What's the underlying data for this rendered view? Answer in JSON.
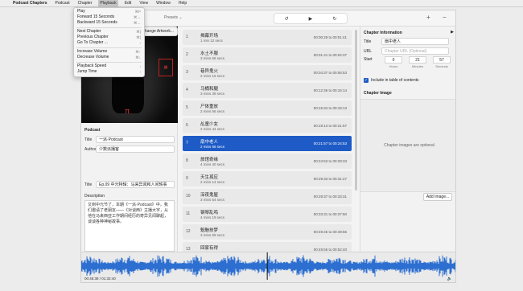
{
  "menubar": {
    "apple": "",
    "app": "Podcast Chapters",
    "items": [
      "Podcast",
      "Chapter",
      "Playback",
      "Edit",
      "View",
      "Window",
      "Help"
    ]
  },
  "menu": {
    "items": [
      {
        "label": "Play",
        "shortcut": "⌘P"
      },
      {
        "label": "Forward 15 Seconds",
        "shortcut": "⌘→"
      },
      {
        "label": "Backward 15 Seconds",
        "shortcut": "⌘←"
      },
      {
        "sep": true
      },
      {
        "label": "Next Chapter",
        "shortcut": "⌘]"
      },
      {
        "label": "Previous Chapter",
        "shortcut": "⌘["
      },
      {
        "label": "Go To Chapter ...",
        "shortcut": "›"
      },
      {
        "sep": true
      },
      {
        "label": "Increase Volume",
        "shortcut": "⌘↑"
      },
      {
        "label": "Decrease Volume",
        "shortcut": "⌘↓"
      },
      {
        "sep": true
      },
      {
        "label": "Playback Speed",
        "shortcut": "›"
      },
      {
        "label": "Jump Time",
        "shortcut": "›"
      }
    ]
  },
  "toolbar": {
    "presets": "Presets ⌄",
    "back": "↺",
    "play": "▶",
    "fwd": "↻",
    "plus": "+",
    "minus": "−"
  },
  "art": {
    "button": "Change Artwork...",
    "pi": "π"
  },
  "podcast": {
    "header": "Podcast",
    "title_label": "Title",
    "title": "一派·Podcast",
    "author_label": "Author",
    "author": "少数派播客",
    "ep_label": "Title",
    "ep_title": "Ep.09 中元特辑：马来异闻和人间轶事",
    "desc_label": "Description",
    "desc": "又到中元节了，本期《一派·Podcast》中，我们邀请了老朋友——《对谈西》主播大宇，从他在马来西亚工作期间经历的奇异见闻聊起，谈谈各种神秘故事。"
  },
  "chapters": [
    {
      "n": "1",
      "title": "揭幕开场",
      "dur": "1 min 12 secs",
      "time": "00:00:29 to 00:01:41"
    },
    {
      "n": "2",
      "title": "水土不服",
      "dur": "3 mins 56 secs",
      "time": "00:01:41 to 00:04:37"
    },
    {
      "n": "3",
      "title": "巷异鬼火",
      "dur": "2 mins 16 secs",
      "time": "00:04:37 to 00:06:53"
    },
    {
      "n": "4",
      "title": "马桶和腿",
      "dur": "3 mins 38 secs",
      "time": "00:12:36 to 00:16:14"
    },
    {
      "n": "5",
      "title": "尸体重放",
      "dur": "2 mins 56 secs",
      "time": "00:16:34 to 00:19:13"
    },
    {
      "n": "6",
      "title": "乩童少女",
      "dur": "2 mins 44 secs",
      "time": "00:19:13 to 00:21:57"
    },
    {
      "n": "7",
      "title": "扇中老人",
      "dur": "2 mins 56 secs",
      "time": "00:21:57 to 00:24:53"
    },
    {
      "n": "8",
      "title": "旅馆奇缘",
      "dur": "4 mins 40 secs",
      "time": "00:24:53 to 00:29:33"
    },
    {
      "n": "9",
      "title": "天生孤应",
      "dur": "2 mins 14 secs",
      "time": "00:29:33 to 00:31:47"
    },
    {
      "n": "10",
      "title": "深夜鬼屋",
      "dur": "3 mins 54 secs",
      "time": "00:29:37 to 00:33:31"
    },
    {
      "n": "11",
      "title": "钢琴乱鸣",
      "dur": "4 mins 19 secs",
      "time": "00:33:31 to 00:37:50"
    },
    {
      "n": "12",
      "title": "魁魅技梦",
      "dur": "3 mins 59 secs",
      "time": "00:49:46 to 00:49:56"
    },
    {
      "n": "13",
      "title": "回家有得",
      "dur": "2 mins 44 secs",
      "time": "00:49:56 to 00:52:40"
    }
  ],
  "selected_index": 6,
  "chapter_info": {
    "header": "Chapter Information",
    "title_label": "Title",
    "title": "扇中老人",
    "url_label": "URL",
    "url_placeholder": "Chapter URL (Optional)",
    "start_label": "Start",
    "hours": "0",
    "minutes": "21",
    "seconds": "57",
    "hours_cap": "Hours",
    "minutes_cap": "Minutes",
    "seconds_cap": "Seconds",
    "toc_label": "Include in table of contents",
    "toc_checked": true
  },
  "chapter_image": {
    "header": "Chapter Image",
    "placeholder": "Chapter images are optional",
    "add_button": "Add Image..."
  },
  "waveform": {
    "time": "00:45:38 / 01:32:40",
    "volume_icon": "🔈",
    "playhead_fraction": 0.495
  },
  "colors": {
    "accent": "#1e5bc6",
    "wave": "#2d6fd1"
  }
}
